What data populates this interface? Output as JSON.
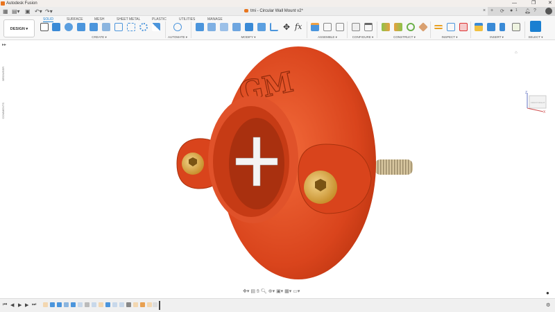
{
  "window": {
    "app_title": "Autodesk Fusion",
    "minimize": "—",
    "restore": "❐",
    "close": "✕"
  },
  "quick_access": {
    "grid_icon": "grid-icon",
    "file_icon": "file-icon",
    "save_icon": "save-icon",
    "undo_icon": "undo-icon",
    "redo_icon": "redo-icon"
  },
  "document": {
    "title": "tmi - Circular Wall Mount v2*",
    "close": "×",
    "new_tab": "+",
    "job_count": "1"
  },
  "workspace": {
    "label": "DESIGN ▾"
  },
  "tabs": [
    "SOLID",
    "SURFACE",
    "MESH",
    "SHEET METAL",
    "PLASTIC",
    "UTILITIES",
    "MANAGE"
  ],
  "active_tab": "SOLID",
  "groups": [
    "CREATE ▾",
    "AUTOMATE ▾",
    "MODIFY ▾",
    "ASSEMBLE ▾",
    "CONFIGURE ▾",
    "CONSTRUCT ▾",
    "INSPECT ▾",
    "INSERT ▾",
    "SELECT ▾"
  ],
  "side_panels": [
    "BROWSER",
    "COMMENTS"
  ],
  "viewcube": {
    "axis_z": "Z",
    "axis_x": "X",
    "face_front": "FRONT",
    "face_right": "RIGHT"
  },
  "colors": {
    "accent": "#1a7fd1",
    "model": "#d9441c",
    "screw": "#d7a443"
  }
}
